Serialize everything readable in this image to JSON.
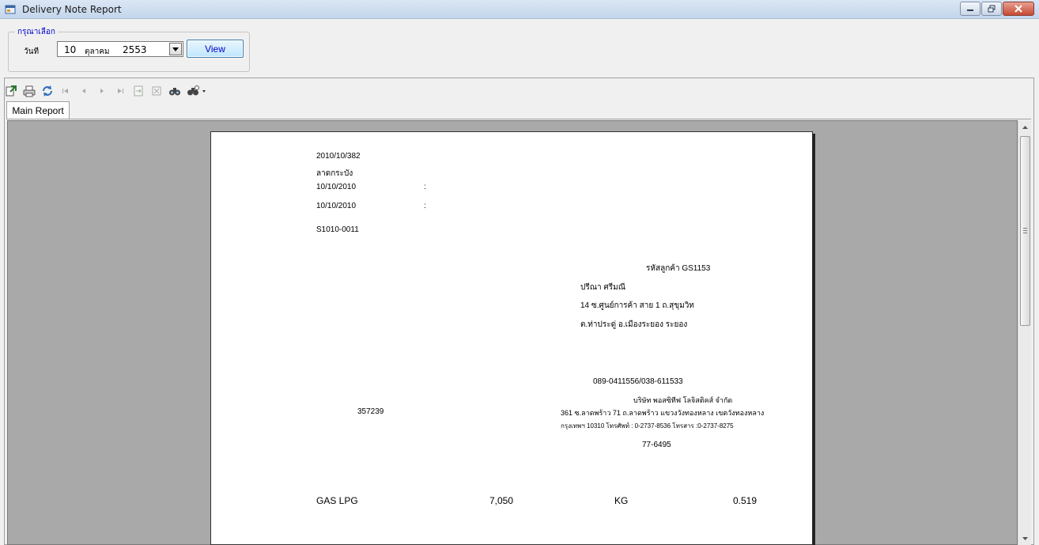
{
  "window": {
    "title": "Delivery Note Report"
  },
  "filter": {
    "group_label": "กรุณาเลือก",
    "date_label": "วันที",
    "date_day": "10",
    "date_month": "ตุลาคม",
    "date_year": "2553",
    "view_button": "View"
  },
  "toolbar": {
    "icons": [
      "export-icon",
      "print-icon",
      "refresh-icon",
      "first-page-icon",
      "previous-page-icon",
      "next-page-icon",
      "last-page-icon",
      "goto-page-icon",
      "close-view-icon",
      "search-icon",
      "zoom-icon"
    ]
  },
  "tabs": {
    "main": "Main Report"
  },
  "report": {
    "doc_no": "2010/10/382",
    "branch": "ลาดกระบัง",
    "date1": "10/10/2010",
    "colon1": ":",
    "date2": "10/10/2010",
    "colon2": ":",
    "code": "S1010-0011",
    "customer_code": "รหัสลูกค้า GS1153",
    "customer_name": "ปรีณา ศรีมณี",
    "address1": "14 ซ.ศูนย์การค้า สาย 1 ถ.สุขุมวิท",
    "address2": "ต.ท่าประดู่ อ.เมืองระยอง ระยอง",
    "phone": "089-0411556/038-611533",
    "company": "บริษัท พอสซิทีฟ โลจิสติคส์ จำกัด",
    "company_addr1": "361 ซ.ลาดพร้าว 71 ถ.ลาดพร้าว แขวงวังทองหลาง เขตวังทองหลาง",
    "company_addr2": "กรุงเทพฯ 10310 โทรศัพท์ : 0-2737-8536 โทรสาร :0-2737-8275",
    "ref_no": "357239",
    "plate": "77-6495",
    "item_name": "GAS LPG",
    "item_qty": "7,050",
    "item_unit": "KG",
    "item_value": "0.519"
  }
}
